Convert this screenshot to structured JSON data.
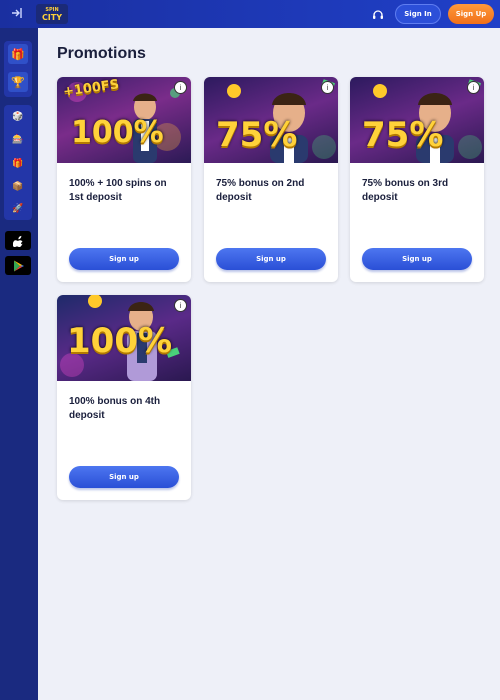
{
  "header": {
    "logo_top": "SPIN",
    "logo_bottom": "CITY",
    "signin_label": "Sign In",
    "signup_label": "Sign Up"
  },
  "page": {
    "title": "Promotions"
  },
  "promotions": [
    {
      "title": "100% + 100 spins on 1st deposit",
      "image_text_main": "100%",
      "image_text_top": "+100FS",
      "button": "Sign up"
    },
    {
      "title": "75% bonus on 2nd deposit",
      "image_text_main": "75%",
      "button": "Sign up"
    },
    {
      "title": "75% bonus on 3rd deposit",
      "image_text_main": "75%",
      "button": "Sign up"
    },
    {
      "title": "100% bonus on 4th deposit",
      "image_text_main": "100%",
      "button": "Sign up"
    }
  ],
  "colors": {
    "accent": "#2a4fd6",
    "signup": "#f0701a",
    "sidebar": "#1a2a80",
    "background": "#eef0f8"
  }
}
